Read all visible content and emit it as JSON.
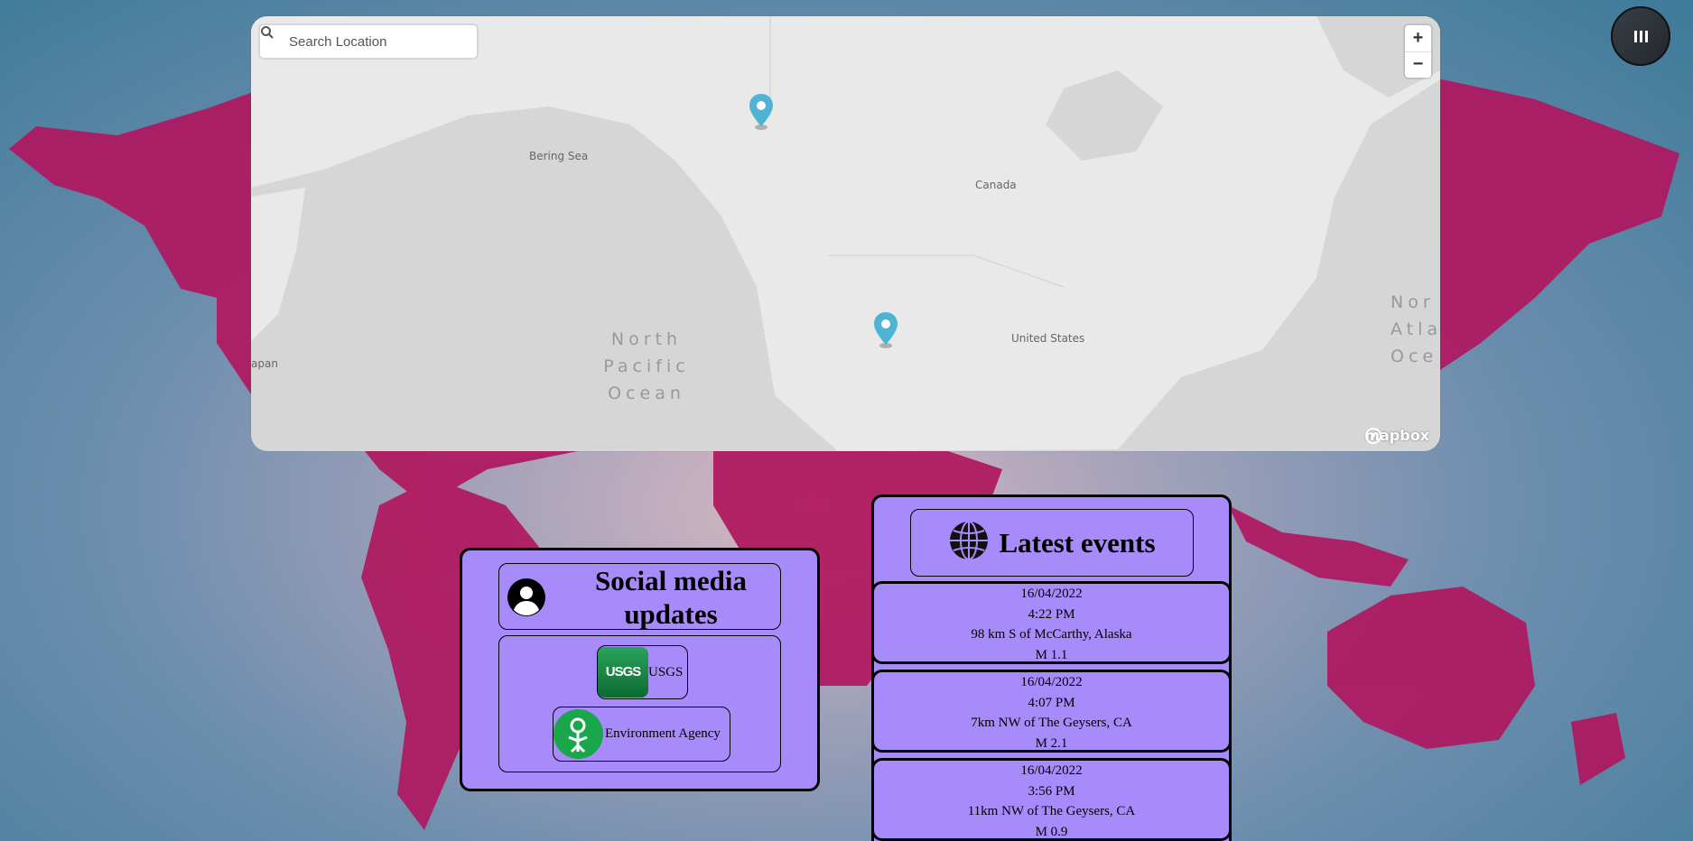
{
  "search": {
    "placeholder": "Search Location"
  },
  "map": {
    "zoom_in": "+",
    "zoom_out": "−",
    "labels": {
      "bering_sea": "Bering Sea",
      "canada": "Canada",
      "united_states": "United States",
      "japan": "apan"
    },
    "ocean_labels": {
      "north_pacific": [
        "North",
        "Pacific",
        "Ocean"
      ],
      "north_atlantic": [
        "Nor",
        "Atla",
        "Oce"
      ]
    },
    "attribution": "mapbox",
    "markers": [
      "alaska-marker",
      "california-marker"
    ]
  },
  "colors": {
    "panel_bg": "#a78bfa",
    "map_bg": "#d6d6d6",
    "marker": "#4fb3d4",
    "continent": "#b0175f"
  },
  "social": {
    "title": "Social media updates",
    "sources": [
      {
        "name": "USGS",
        "logo_text": "USGS"
      },
      {
        "name": "Environment Agency"
      }
    ]
  },
  "events": {
    "title": "Latest events",
    "items": [
      {
        "date": "16/04/2022",
        "time": "4:22 PM",
        "place": "98 km S of McCarthy, Alaska",
        "mag": "M 1.1"
      },
      {
        "date": "16/04/2022",
        "time": "4:07 PM",
        "place": "7km NW of The Geysers, CA",
        "mag": "M 2.1"
      },
      {
        "date": "16/04/2022",
        "time": "3:56 PM",
        "place": "11km NW of The Geysers, CA",
        "mag": "M 0.9"
      }
    ]
  }
}
